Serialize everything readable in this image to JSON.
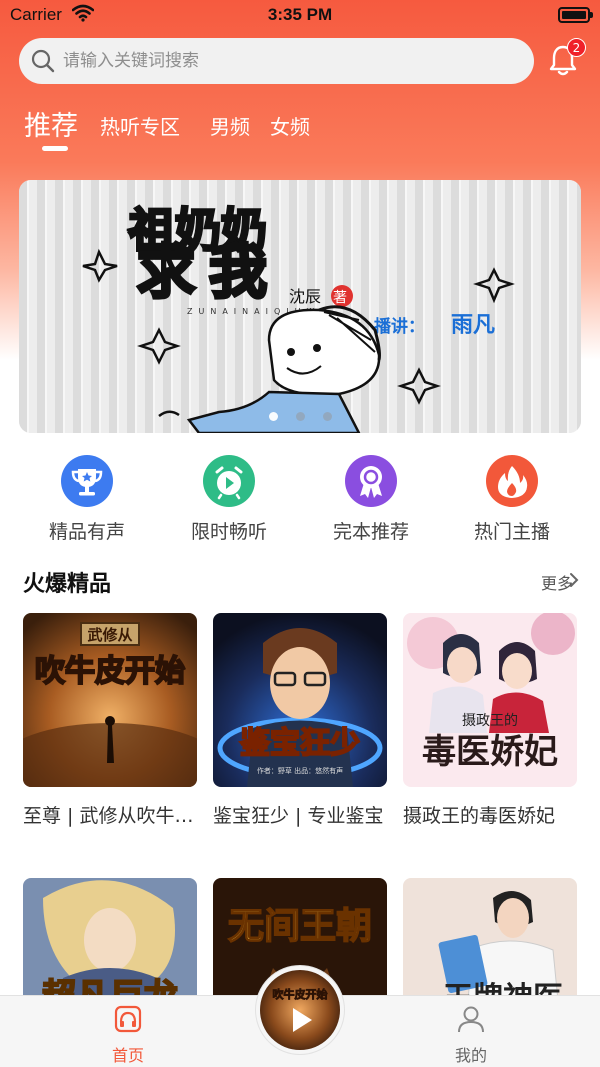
{
  "status_bar": {
    "carrier": "Carrier",
    "time": "3:35 PM"
  },
  "search": {
    "placeholder": "请输入关键词搜索"
  },
  "notifications": {
    "badge": "2"
  },
  "tabs": [
    {
      "label": "推荐",
      "active": true
    },
    {
      "label": "热听专区",
      "active": false
    },
    {
      "label": "男频",
      "active": false
    },
    {
      "label": "女频",
      "active": false
    }
  ],
  "banner": {
    "title": "祖奶奶求我",
    "author": "沈辰",
    "author_suffix": "著",
    "pinyin": "ZUNAINAIQIUWO",
    "narrator_label": "播讲：",
    "narrator": "雨凡",
    "slides": 3,
    "current_slide": 1
  },
  "categories": [
    {
      "label": "精品有声",
      "icon": "trophy-icon",
      "color": "#3d7bf0"
    },
    {
      "label": "限时畅听",
      "icon": "alarm-clock-icon",
      "color": "#2ebc87"
    },
    {
      "label": "完本推荐",
      "icon": "medal-icon",
      "color": "#8a4ee0"
    },
    {
      "label": "热门主播",
      "icon": "flame-icon",
      "color": "#f2583a"
    }
  ],
  "section": {
    "title": "火爆精品",
    "more": "更多"
  },
  "books_row1": [
    {
      "name": "至尊 | 武修从吹牛皮开始",
      "cover_text": "吹牛皮开始",
      "cover_top": "武修从"
    },
    {
      "name": "鉴宝狂少 | 专业鉴宝",
      "cover_text": "鉴宝狂少",
      "cover_small": "作者：野草    出品：悠然有声"
    },
    {
      "name": "摄政王的毒医娇妃",
      "cover_text": "毒医娇妃",
      "cover_top": "摄政王的"
    }
  ],
  "books_row2": [
    {
      "name": "超凡巨龙",
      "cover_text": "超凡巨龙"
    },
    {
      "name": "无间王朝",
      "cover_text": "无间王朝"
    },
    {
      "name": "王牌神医",
      "cover_text": "王牌神医"
    }
  ],
  "tabbar": {
    "home": "首页",
    "mine": "我的",
    "now_playing_cover": "吹牛皮开始",
    "accent": "#f2583a"
  }
}
